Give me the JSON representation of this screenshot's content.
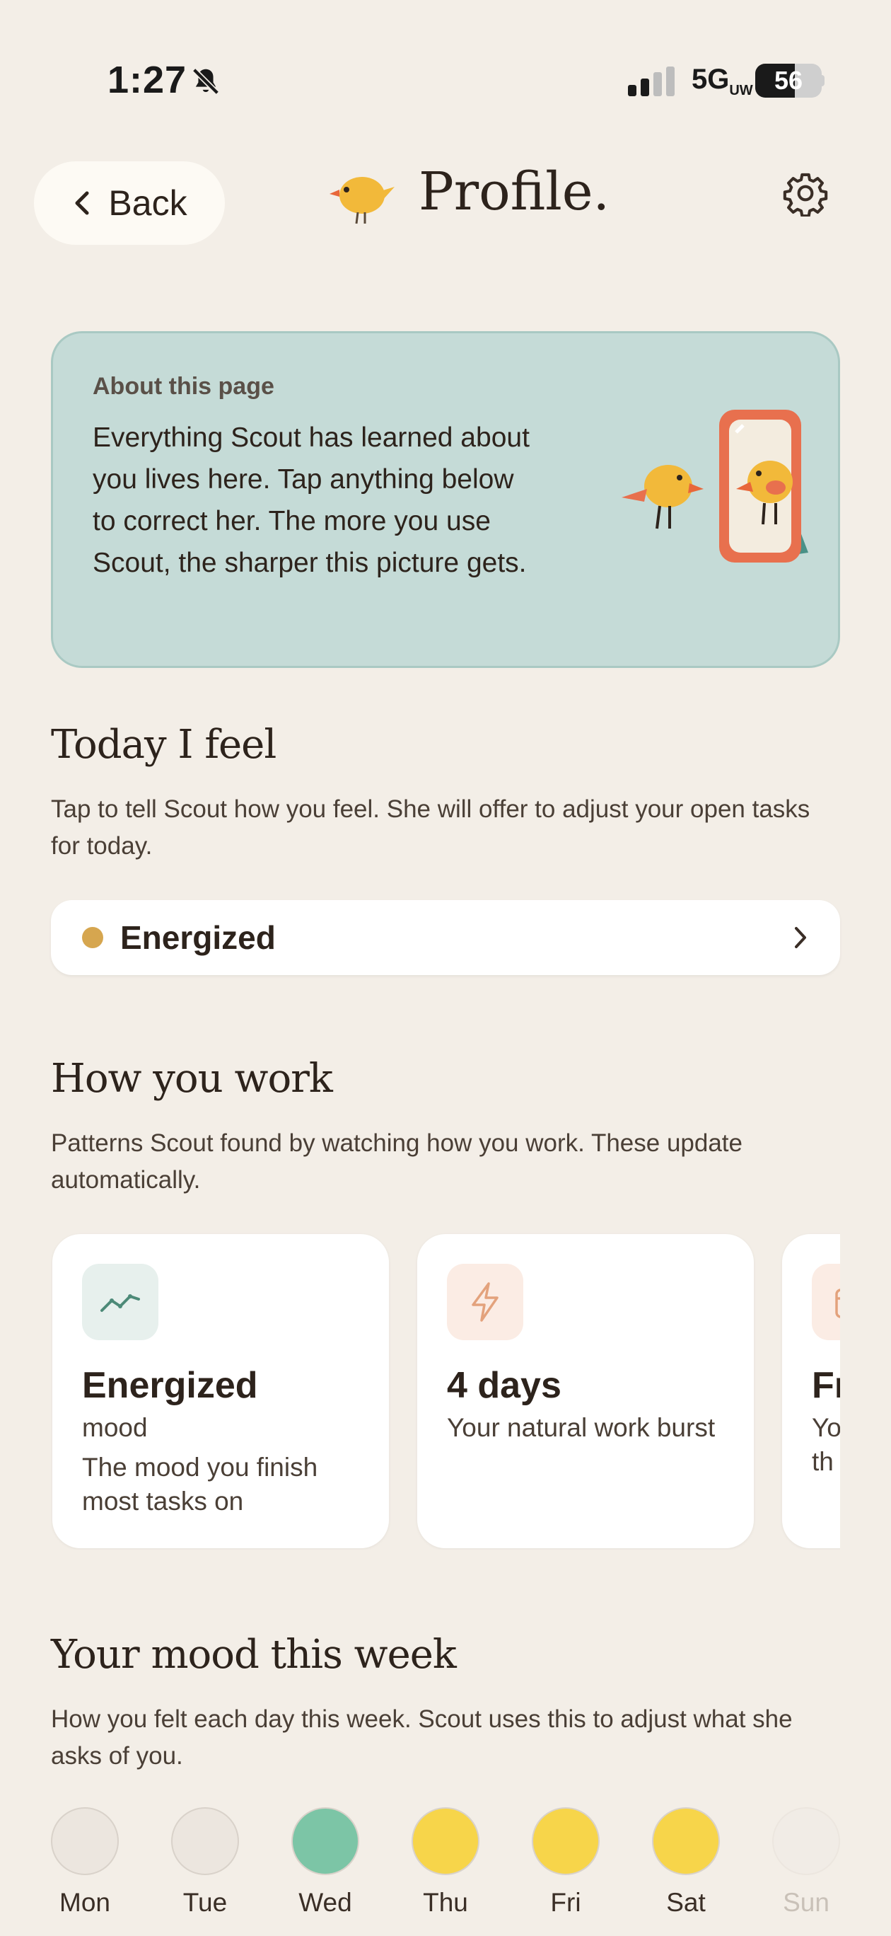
{
  "status": {
    "time": "1:27",
    "network": "5G",
    "network_sub": "UW",
    "battery": "56"
  },
  "header": {
    "back_label": "Back",
    "title": "Profile."
  },
  "about": {
    "label": "About this page",
    "text": "Everything Scout has learned about you lives here. Tap anything below to correct her. The more you use Scout, the sharper this picture gets."
  },
  "today": {
    "heading": "Today I feel",
    "description": "Tap to tell Scout how you feel. She will offer to adjust your open tasks for today.",
    "mood": "Energized",
    "mood_color": "#d6a64f"
  },
  "work": {
    "heading": "How you work",
    "description": "Patterns Scout found by watching how you work. These update automatically.",
    "cards": [
      {
        "icon": "trend-line-icon",
        "value": "Energized",
        "sub": "mood",
        "desc": "The mood you finish most tasks on",
        "icon_bg": "#e7f0ed",
        "icon_color": "#4d8a78"
      },
      {
        "icon": "lightning-icon",
        "value": "4 days",
        "sub": "Your natural work burst",
        "desc": "",
        "icon_bg": "#fbece4",
        "icon_color": "#e3a27c"
      },
      {
        "icon": "calendar-icon",
        "value": "Fr",
        "sub": "Yo",
        "desc": "th",
        "icon_bg": "#fbece4",
        "icon_color": "#e3a27c"
      }
    ]
  },
  "week": {
    "heading": "Your mood this week",
    "description": "How you felt each day this week. Scout uses this to adjust what she asks of you.",
    "days": [
      {
        "label": "Mon",
        "color": "#ece6df"
      },
      {
        "label": "Tue",
        "color": "#ece6df"
      },
      {
        "label": "Wed",
        "color": "#7cc5a6"
      },
      {
        "label": "Thu",
        "color": "#f7d54a"
      },
      {
        "label": "Fri",
        "color": "#f7d54a"
      },
      {
        "label": "Sat",
        "color": "#f7d54a"
      },
      {
        "label": "Sun",
        "color": "#f1ece6"
      }
    ]
  }
}
